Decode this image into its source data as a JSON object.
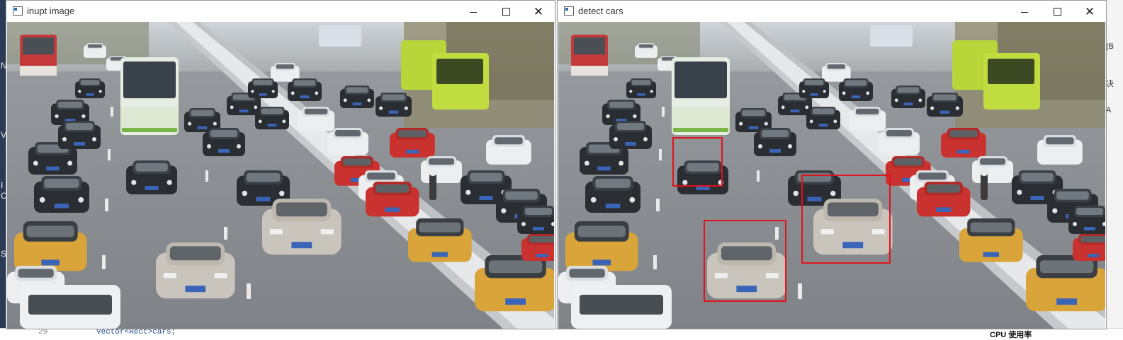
{
  "windows": {
    "input": {
      "title": "inupt image",
      "icon": "opencv-window-icon"
    },
    "output": {
      "title": "detect cars",
      "icon": "opencv-window-icon",
      "detections_color": "#e0121b"
    }
  },
  "background": {
    "code_line_number": "29",
    "code_text": "vector<Rect>cars;",
    "cpu_label": "CPU 使用率",
    "left_edge_chars": [
      "N",
      "V",
      "I",
      "C",
      "S"
    ],
    "right_edge_chars": [
      "(B",
      "决",
      "A"
    ]
  },
  "palette": {
    "titlebar": "#ffffff",
    "road": "#8c9196",
    "sky": "#c9ced3",
    "detection_box": "#e0121b"
  }
}
